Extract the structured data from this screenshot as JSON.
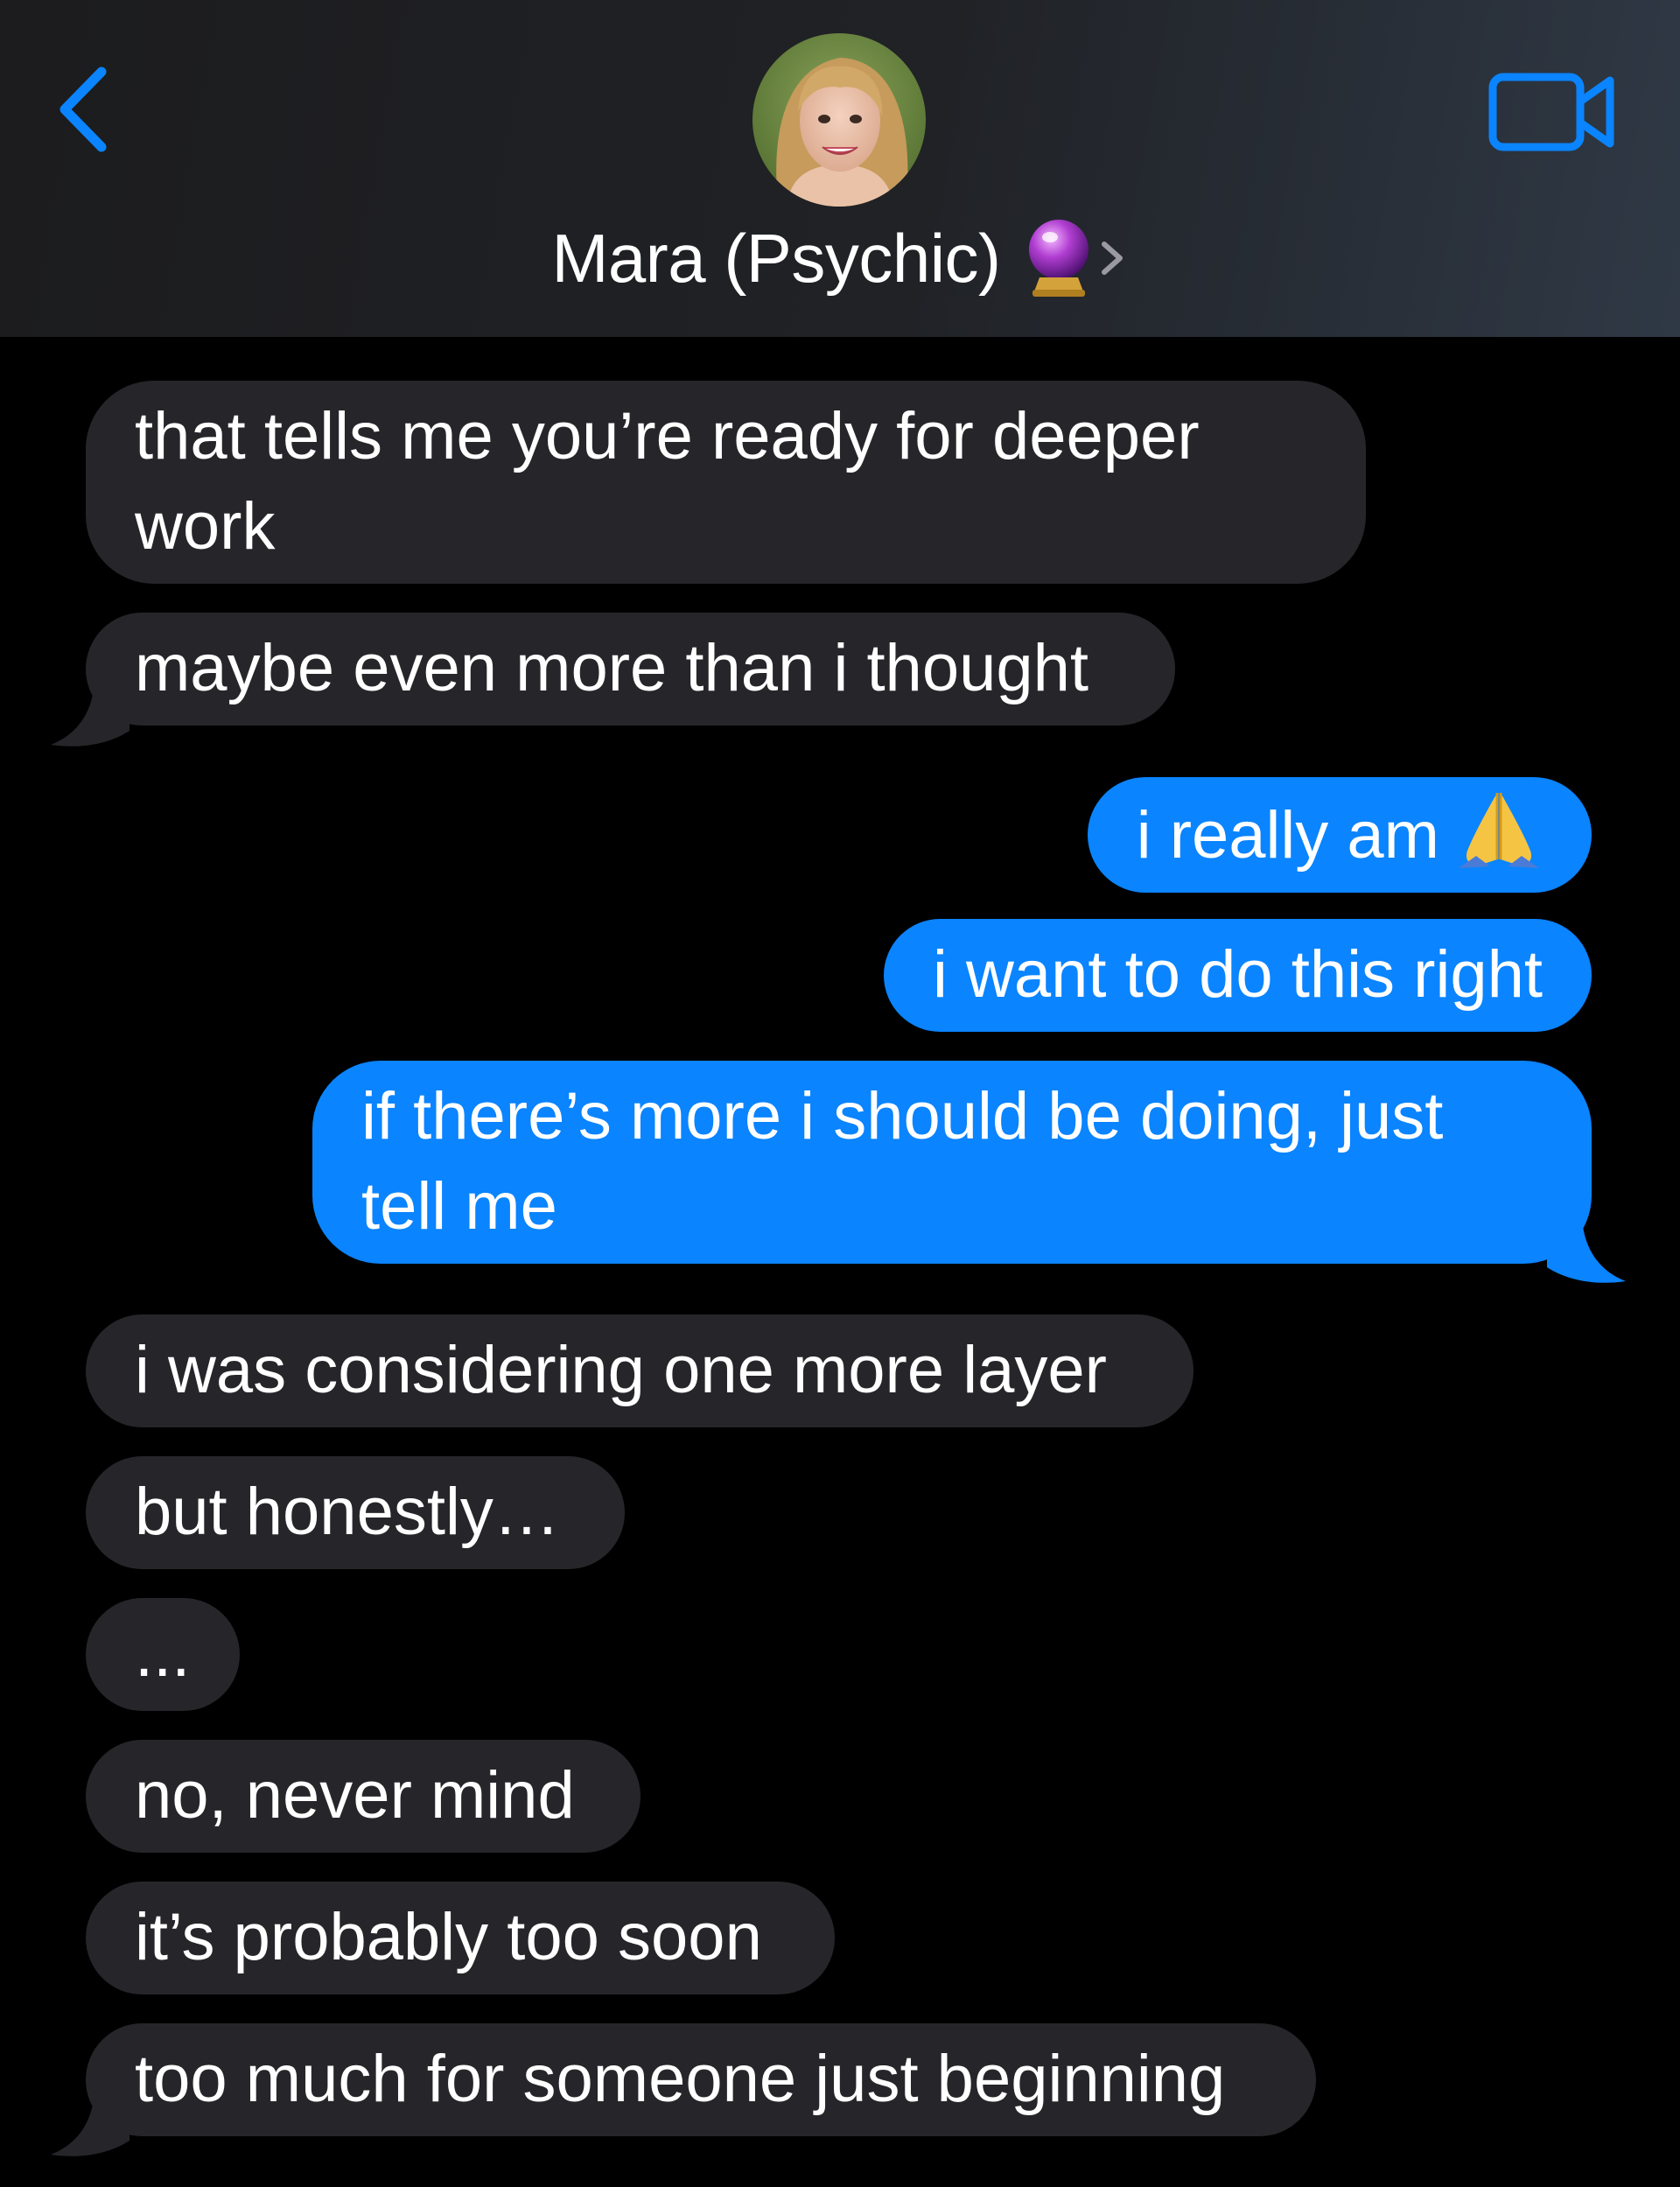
{
  "header": {
    "back_icon": "chevron-left-icon",
    "contact_name": "Mara (Psychic)",
    "contact_emoji": "crystal-ball-icon",
    "video_icon": "video-camera-icon",
    "accent_color": "#0a84ff"
  },
  "messages": [
    {
      "direction": "incoming",
      "text": "that tells me you’re ready for deeper work"
    },
    {
      "direction": "incoming",
      "text": "maybe even more than i thought"
    },
    {
      "direction": "outgoing",
      "text": "i really am",
      "emoji": "folded-hands-icon"
    },
    {
      "direction": "outgoing",
      "text": "i want to do this right"
    },
    {
      "direction": "outgoing",
      "text": "if there’s more i should be doing, just tell me"
    },
    {
      "direction": "incoming",
      "text": "i was considering one more layer"
    },
    {
      "direction": "incoming",
      "text": "but honestly…"
    },
    {
      "direction": "incoming",
      "text": "..."
    },
    {
      "direction": "incoming",
      "text": "no, never mind"
    },
    {
      "direction": "incoming",
      "text": "it’s probably too soon"
    },
    {
      "direction": "incoming",
      "text": "too much for someone just beginning"
    }
  ],
  "colors": {
    "incoming_bubble": "#26262a",
    "outgoing_bubble": "#0a84ff",
    "background": "#000000"
  }
}
